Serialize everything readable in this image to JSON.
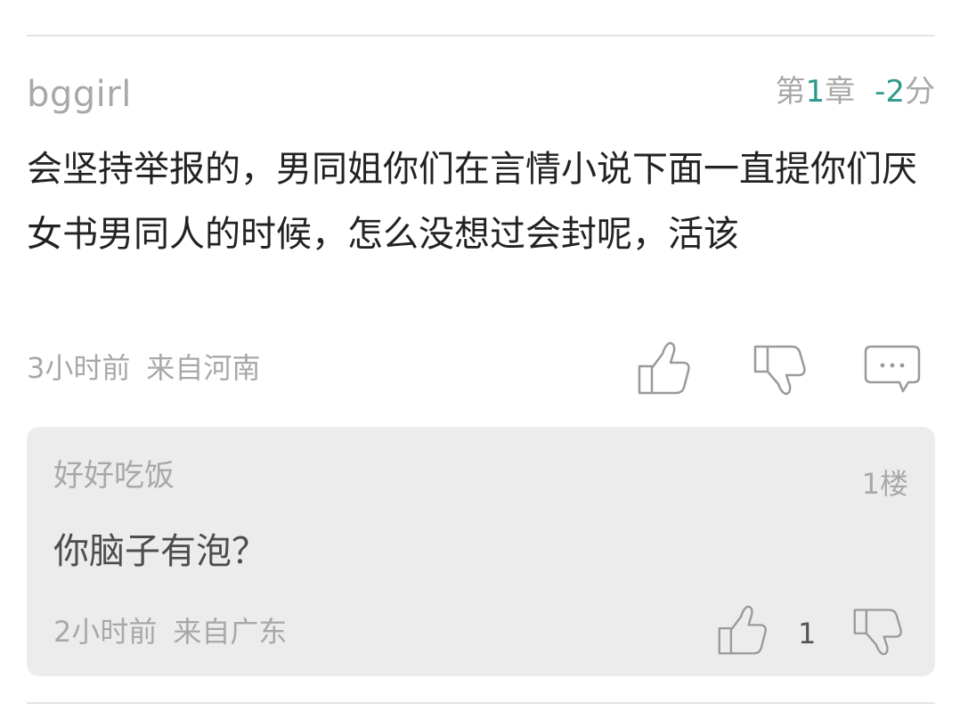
{
  "comment": {
    "username": "bggirl",
    "chapter_prefix": "第",
    "chapter_number": "1",
    "chapter_suffix": "章",
    "score_value": "-2",
    "score_unit": "分",
    "content": "会坚持举报的，男同姐你们在言情小说下面一直提你们厌女书男同人的时候，怎么没想过会封呢，活该",
    "time": "3小时前",
    "location": "来自河南",
    "icons": {
      "like": "thumbs-up-icon",
      "dislike": "thumbs-down-icon",
      "reply": "comment-bubble-icon"
    },
    "accent_color": "#2e9a8c"
  },
  "reply": {
    "username": "好好吃饭",
    "floor": "1楼",
    "content": "你脑子有泡？",
    "time": "2小时前",
    "location": "来自广东",
    "like_count": "1"
  }
}
